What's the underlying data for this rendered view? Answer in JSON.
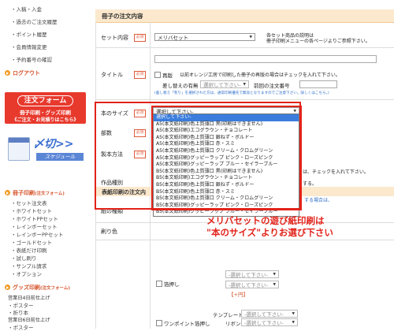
{
  "sidebar": {
    "top_links": [
      "入稿・入金",
      "過去のご注文履歴",
      "ポイント履歴",
      "会員情報変更",
      "予約番号の確認"
    ],
    "logout": "ログアウト",
    "order_banner": {
      "title": "注文フォーム",
      "line2": "冊子印刷・グッズ印刷",
      "line3": "《ご注文・お見積りはこちら》"
    },
    "schedule_banner": {
      "big": "〆切>>",
      "small": "スケジュール"
    },
    "booklet_head": "冊子印刷",
    "booklet_head_small": "(注文フォーム)",
    "booklet_links": [
      "セット注文表",
      "ホワイトセット",
      "ホワイトPPセット",
      "レインボーセット",
      "レインボーPPセット",
      "ゴールドセット",
      "表紙だけ印刷",
      "試し刷り",
      "サンプル請求",
      "オプション"
    ],
    "goods_head": "グッズ印刷",
    "goods_head_small": "(注文フォーム)",
    "goods_links": [
      "営業日4日前仕上げ",
      "ポスター",
      "折り本",
      "営業日6日前仕上げ",
      "ポスター"
    ]
  },
  "main": {
    "section_title": "冊子の注文内容",
    "required": "必須",
    "rows": {
      "set": {
        "label": "セット内容",
        "value": "メリバセット",
        "note1": "各セット商品の説明は",
        "note2": "冊子印刷メニューの各ページよりご参照下さい。"
      },
      "title": {
        "label": "タイトル"
      },
      "reprint": {
        "check": "再版",
        "note": "以前オレンジ工房で印刷した冊子の再版の場合はチェックを入れて下さい。"
      },
      "replace": {
        "label": "差し替えの有無",
        "select": "選択して下さい-",
        "prev_label": "前回の注文番号",
        "note": "(差し替え「有り」を選択された方は、通常印刷優先で無効となりますのでご注意下さい。詳しくはこちら。)"
      },
      "size": {
        "label": "本のサイズ",
        "value": "選択して下さい-"
      },
      "pages": {
        "label": "部数"
      },
      "binding": {
        "label": "製本方法"
      },
      "genre": {
        "label": "作品種別",
        "note_right1": "は、チェックを入れて下さい。",
        "note_right2": "する。"
      }
    },
    "size_options": [
      "選択して下さい-",
      "A5(本文紙印刷)色上質薄口 黒(印刷はできません)",
      "A5(本文紙印刷)エコグラウン・チョコレート",
      "A5(本文紙印刷)色上質薄口 銀ねず・ボルドー",
      "A5(本文紙印刷)色上質薄口 赤・スミ",
      "A5(本文紙印刷)色上質薄口 クリーム・クロムグリーン",
      "A5(本文紙印刷)グッピーラップ ピンク・ローズピンク",
      "A5(本文紙印刷)グッピーラップ ブルー・セイラーブルー",
      "B5(本文紙印刷)色上質薄口 黒(印刷はできません)",
      "B5(本文紙印刷)エコグラウン・チョコレート",
      "B5(本文紙印刷)色上質薄口 銀ねず・ボルドー",
      "B5(本文紙印刷)色上質薄口 赤・スミ",
      "B5(本文紙印刷)色上質薄口 クリーム・クロムグリーン",
      "B5(本文紙印刷)グッピーラップ ピンク・ローズピンク",
      "B5(本文紙印刷)グッピーラップ ブルー・セイラーブルー"
    ],
    "cover_section": "表紙印刷の注文内",
    "cover_rows": {
      "paper": {
        "label": "紙の種類",
        "note": "する場合は、"
      },
      "print_color": {
        "label": "刷り色"
      },
      "foil": {
        "check": "箔押し",
        "select1": "-選択して下さい-",
        "select2": "-選択して下さい-",
        "price": "【+円】"
      },
      "template": {
        "label": "テンプレート",
        "select": "-選択して下さい-"
      },
      "onepoint": {
        "check": "ワンポイント箔押し",
        "ribbon_label": "リボン",
        "select": "-選択して下さい-"
      }
    },
    "callout": {
      "line1": "メリバセットの遊び紙印刷は",
      "line2": "\"本のサイズ\"よりお選び下さい"
    }
  },
  "colors": {
    "accent": "#e2231a",
    "section_bg": "#fbe8cd",
    "selected": "#3b7ddd"
  }
}
